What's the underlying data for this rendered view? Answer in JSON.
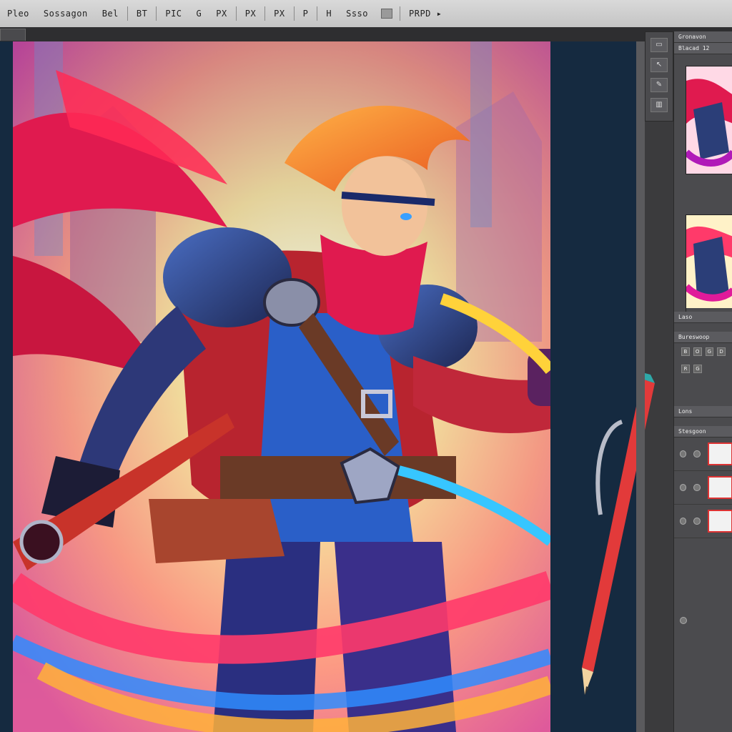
{
  "menubar": {
    "items": [
      "Pleo",
      "Sossagon",
      "Bel",
      "BT",
      "PIC",
      "G",
      "PX",
      "PX",
      "PX",
      "P",
      "H",
      "Ssso"
    ],
    "right": "PRPD ▸"
  },
  "tabbar": {
    "tab_label": ""
  },
  "toolstrip": {
    "tools": [
      "▭",
      "↖",
      "✎",
      "▥"
    ]
  },
  "panels": {
    "navigator": {
      "title": "Gronavon",
      "subtitle": "Blacad 12"
    },
    "adjustments": {
      "title": "Laso",
      "subtitle": "Bureswoop",
      "icons": [
        "B",
        "O",
        "G",
        "D",
        "R",
        "G"
      ]
    },
    "layers": {
      "title": "Lons",
      "subtitle": "Stesgoon",
      "rows": 3
    }
  },
  "colors": {
    "accent": "#e01a4f",
    "sky": "#9fe0ff",
    "pasteboard": "#152a40",
    "armor": "#2b3e78"
  }
}
